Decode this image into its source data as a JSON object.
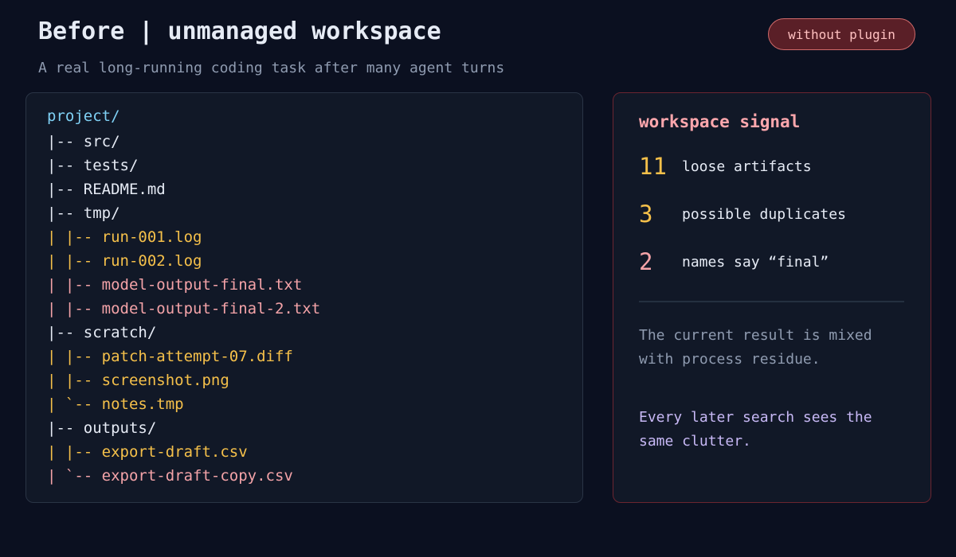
{
  "header": {
    "title": "Before | unmanaged workspace",
    "subtitle": "A real long-running coding task after many agent turns",
    "badge": "without plugin"
  },
  "tree": {
    "lines": [
      {
        "text": "project/",
        "color": "#7fd1f5"
      },
      {
        "text": "|-- src/",
        "color": "#e6ebf5"
      },
      {
        "text": "|-- tests/",
        "color": "#e6ebf5"
      },
      {
        "text": "|-- README.md",
        "color": "#e6ebf5"
      },
      {
        "text": "|-- tmp/",
        "color": "#e6ebf5"
      },
      {
        "text": "| |-- run-001.log",
        "color": "#f5c04a"
      },
      {
        "text": "| |-- run-002.log",
        "color": "#f5c04a"
      },
      {
        "text": "| |-- model-output-final.txt",
        "color": "#f4a3a8"
      },
      {
        "text": "| |-- model-output-final-2.txt",
        "color": "#f4a3a8"
      },
      {
        "text": "|-- scratch/",
        "color": "#e6ebf5"
      },
      {
        "text": "| |-- patch-attempt-07.diff",
        "color": "#f5c04a"
      },
      {
        "text": "| |-- screenshot.png",
        "color": "#f5c04a"
      },
      {
        "text": "| `-- notes.tmp",
        "color": "#f5c04a"
      },
      {
        "text": "|-- outputs/",
        "color": "#e6ebf5"
      },
      {
        "text": "| |-- export-draft.csv",
        "color": "#f5c04a"
      },
      {
        "text": "| `-- export-draft-copy.csv",
        "color": "#f4a3a8"
      }
    ]
  },
  "signal": {
    "heading": "workspace signal",
    "stats": [
      {
        "value": "11",
        "label": "loose artifacts",
        "color": "#f5c04a"
      },
      {
        "value": "3",
        "label": "possible duplicates",
        "color": "#f5c04a"
      },
      {
        "value": "2",
        "label": "names say “final”",
        "color": "#f4a3a8"
      }
    ],
    "note_primary": "The current result is mixed with process residue.",
    "note_secondary": "Every later search sees the same clutter."
  },
  "colors": {
    "background": "#0b1020",
    "panel": "#111827",
    "accent_red": "#ffa7ad",
    "accent_yellow": "#f5c04a",
    "accent_blue": "#7fd1f5"
  }
}
